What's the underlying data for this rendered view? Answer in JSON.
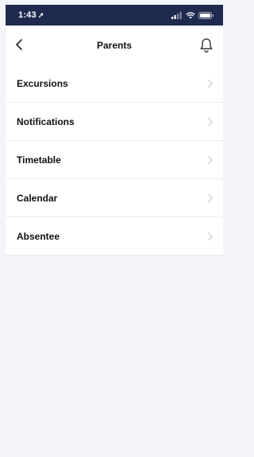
{
  "status_bar": {
    "time": "1:43",
    "location_glyph": "➚",
    "icons": [
      "signal-icon",
      "wifi-icon",
      "battery-icon"
    ]
  },
  "header": {
    "title": "Parents",
    "back_icon": "chevron-left-icon",
    "notification_icon": "bell-icon"
  },
  "menu": {
    "items": [
      {
        "label": "Excursions"
      },
      {
        "label": "Notifications"
      },
      {
        "label": "Timetable"
      },
      {
        "label": "Calendar"
      },
      {
        "label": "Absentee"
      }
    ],
    "chevron_icon": "chevron-right-icon"
  },
  "colors": {
    "status_bar_bg": "#1f2a4f",
    "page_bg": "#f4f5fb",
    "surface": "#ffffff",
    "divider": "#ececf0",
    "text": "#111111",
    "chevron": "#c7c7cc"
  }
}
